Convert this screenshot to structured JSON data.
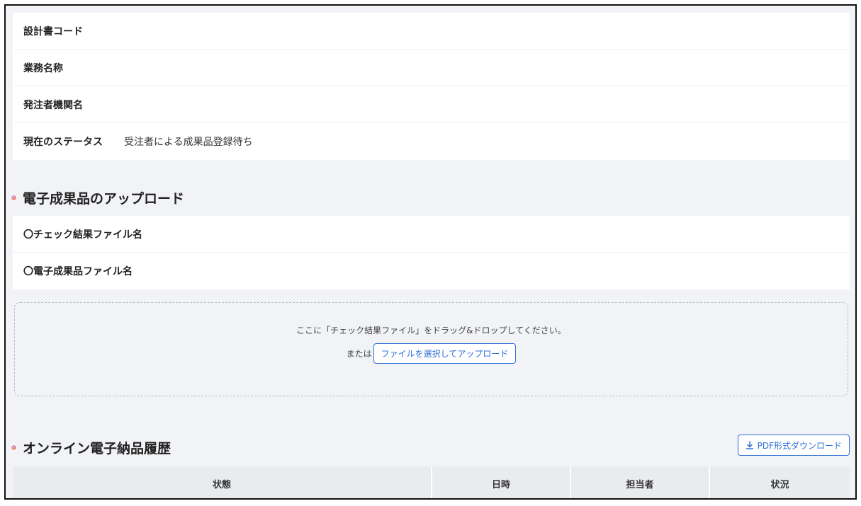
{
  "info": {
    "rows": [
      {
        "label": "設計書コード",
        "value": ""
      },
      {
        "label": "業務名称",
        "value": ""
      },
      {
        "label": "発注者機関名",
        "value": ""
      },
      {
        "label": "現在のステータス",
        "value": "受注者による成果品登録待ち"
      }
    ]
  },
  "upload_section": {
    "title": "電子成果品のアップロード",
    "rows": [
      {
        "label": "〇チェック結果ファイル名"
      },
      {
        "label": "〇電子成果品ファイル名"
      }
    ],
    "dropzone": {
      "text": "ここに「チェック結果ファイル」をドラッグ&ドロップしてください。",
      "or_text": "または",
      "button_label": "ファイルを選択してアップロード"
    }
  },
  "history_section": {
    "title": "オンライン電子納品履歴",
    "pdf_button_label": "PDF形式ダウンロード",
    "columns": [
      "状態",
      "日時",
      "担当者",
      "状況"
    ]
  },
  "colors": {
    "accent": "#2f6fd6",
    "background": "#f2f3f6"
  }
}
